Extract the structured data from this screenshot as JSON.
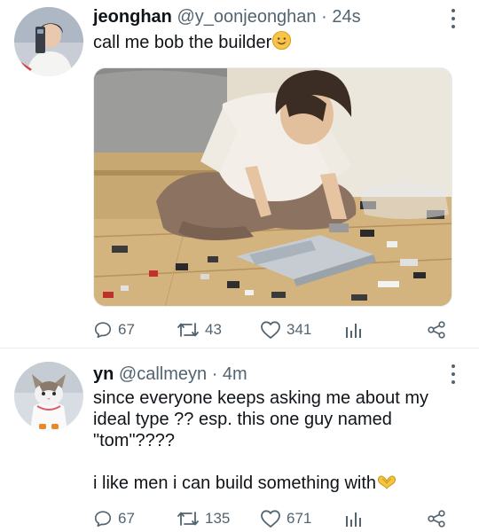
{
  "tweets": [
    {
      "author_name": "jeonghan",
      "handle": "@y_oonjeonghan",
      "dot": "·",
      "time": "24s",
      "text_lines": [
        "call me bob the builder"
      ],
      "emoji_icon": "smiling-face-icon",
      "stats": {
        "replies": "67",
        "retweets": "43",
        "likes": "341"
      }
    },
    {
      "author_name": "yn",
      "handle": "@callmeyn",
      "dot": "·",
      "time": "4m",
      "text_lines": [
        "since everyone keeps asking me about my",
        "ideal type ?? esp. this one guy named",
        "\"tom\"????",
        "",
        "i like men i can build something with"
      ],
      "emoji_icon": "heart-hands-icon",
      "stats": {
        "replies": "67",
        "retweets": "135",
        "likes": "671"
      }
    }
  ],
  "icons": {
    "reply": "reply-icon",
    "retweet": "retweet-icon",
    "like": "heart-icon",
    "analytics": "analytics-icon",
    "share": "share-icon",
    "more": "more-options-icon"
  },
  "colors": {
    "text": "#0f1419",
    "secondary": "#536471",
    "separator": "#e6ecf0"
  }
}
